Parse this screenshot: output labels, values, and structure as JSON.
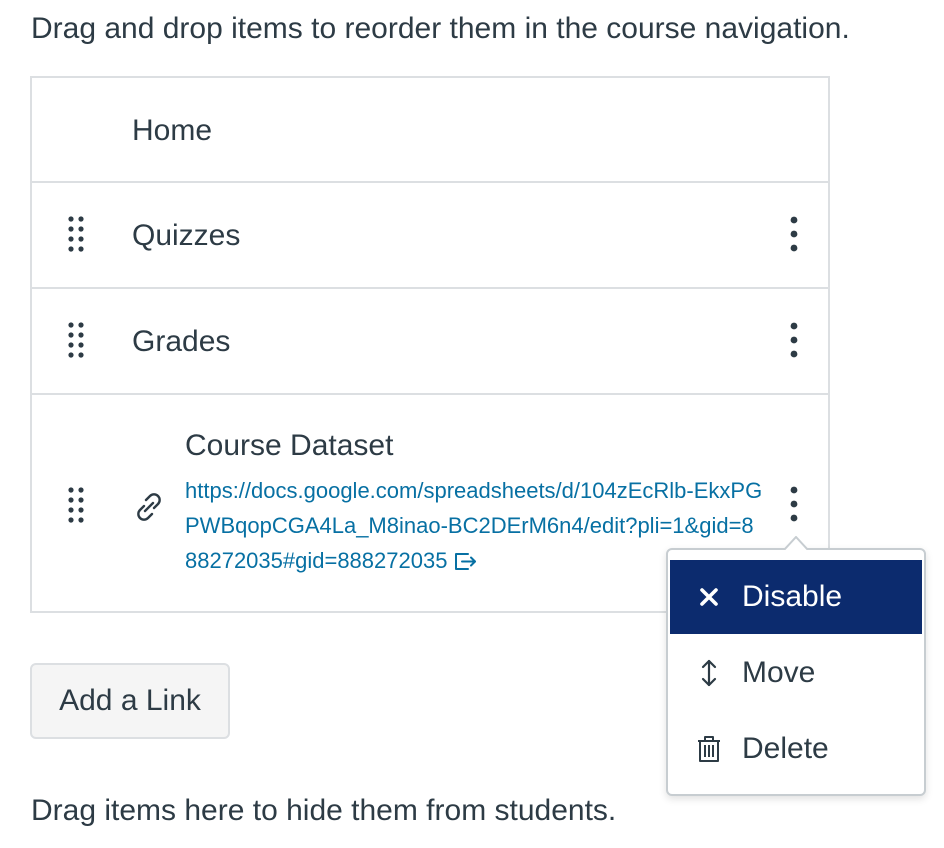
{
  "instructions": "Drag and drop items to reorder them in the course navigation.",
  "nav_items": [
    {
      "label": "Home"
    },
    {
      "label": "Quizzes"
    },
    {
      "label": "Grades"
    }
  ],
  "external_link": {
    "title": "Course Dataset",
    "url": "https://docs.google.com/spreadsheets/d/104zEcRlb-EkxPGPWBqopCGA4La_M8inao-BC2DErM6n4/edit?pli=1&gid=888272035#gid=888272035"
  },
  "add_link_label": "Add a Link",
  "hide_instructions": "Drag items here to hide them from students.",
  "menu": {
    "items": [
      {
        "label": "Disable",
        "icon": "close-icon",
        "active": true
      },
      {
        "label": "Move",
        "icon": "updown-arrow-icon",
        "active": false
      },
      {
        "label": "Delete",
        "icon": "trash-icon",
        "active": false
      }
    ]
  },
  "colors": {
    "text": "#2d3b45",
    "link": "#0770a3",
    "menu_active_bg": "#0c2b6e",
    "border": "#dcdfe2"
  }
}
